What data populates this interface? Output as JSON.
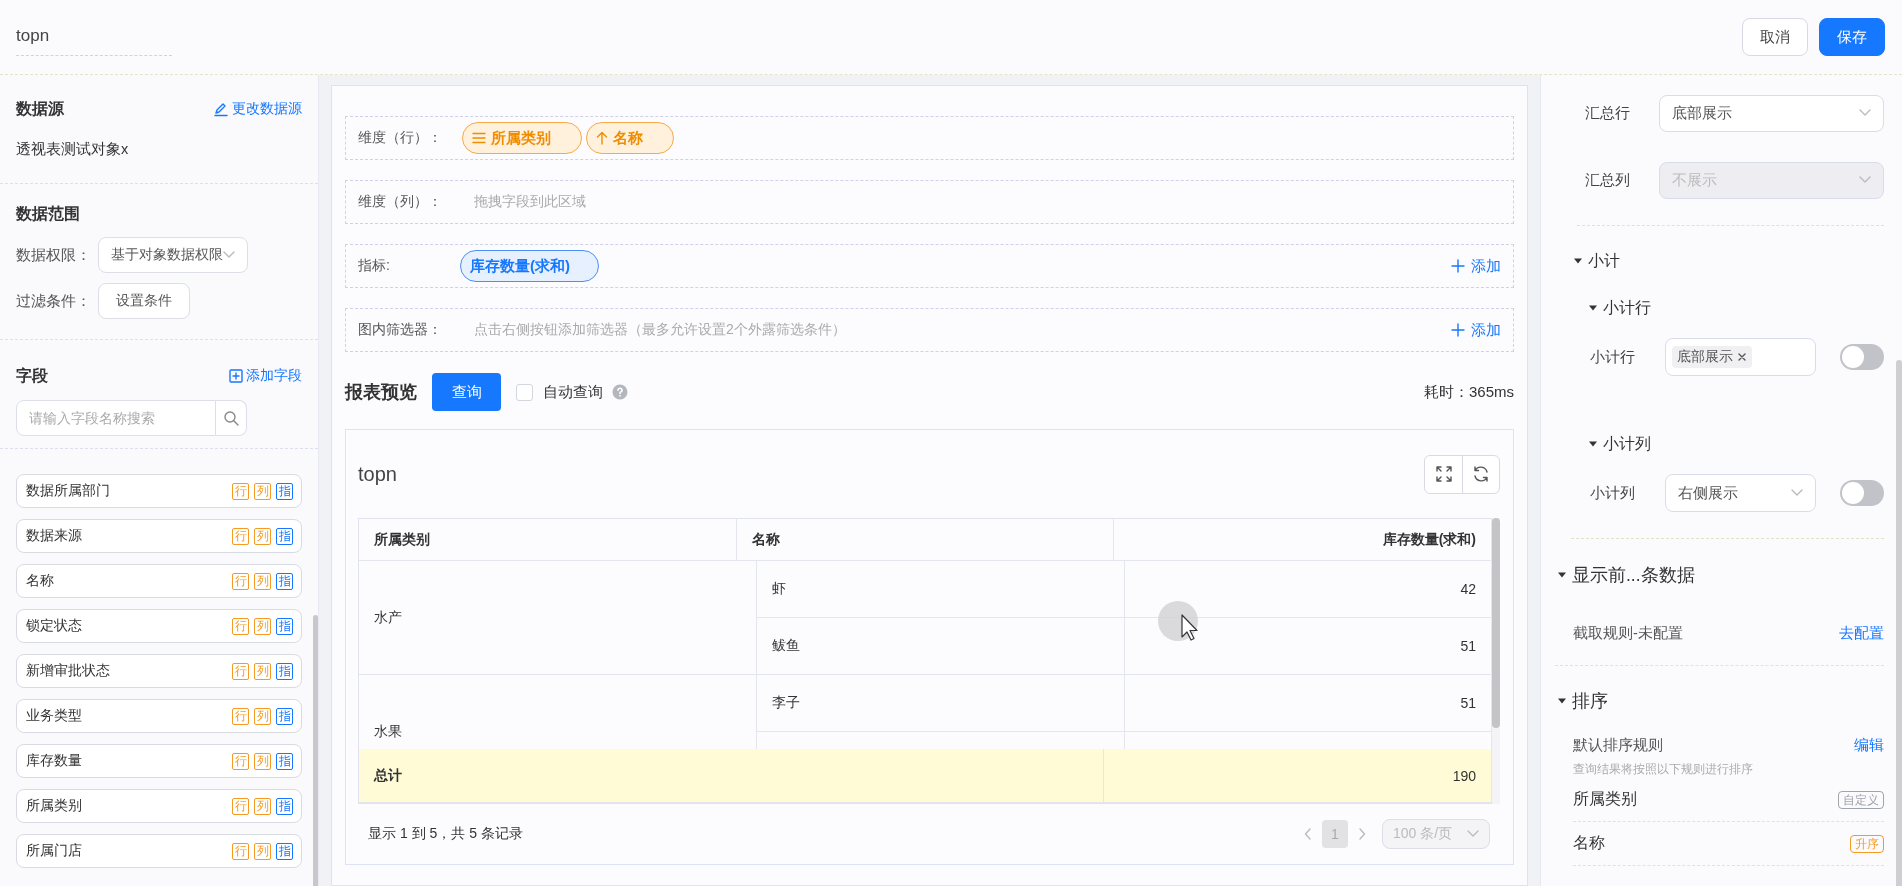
{
  "header": {
    "title": "topn",
    "buttons": [
      {
        "label": "取消",
        "kind": "default"
      },
      {
        "label": "保存",
        "kind": "primary"
      }
    ]
  },
  "datasource": {
    "title": "数据源",
    "action": "更改数据源",
    "value": "透视表测试对象x"
  },
  "data_range": {
    "title": "数据范围",
    "permission": {
      "label": "数据权限：",
      "value": "基于对象数据权限"
    },
    "filter": {
      "label": "过滤条件：",
      "button": "设置条件"
    }
  },
  "fields": {
    "title": "字段",
    "action": "添加字段",
    "search": {
      "placeholder": "请输入字段名称搜索"
    },
    "items": [
      {
        "name": "数据所属部门",
        "tags": [
          {
            "label": "行",
            "color": "#f59a23"
          },
          {
            "label": "列",
            "color": "#f59a23"
          },
          {
            "label": "指",
            "color": "#1677ff"
          }
        ]
      },
      {
        "name": "数据来源",
        "tags": [
          {
            "label": "行",
            "color": "#f59a23"
          },
          {
            "label": "列",
            "color": "#f59a23"
          },
          {
            "label": "指",
            "color": "#1677ff"
          }
        ]
      },
      {
        "name": "名称",
        "tags": [
          {
            "label": "行",
            "color": "#f59a23"
          },
          {
            "label": "列",
            "color": "#f59a23"
          },
          {
            "label": "指",
            "color": "#1677ff"
          }
        ]
      },
      {
        "name": "锁定状态",
        "tags": [
          {
            "label": "行",
            "color": "#f59a23"
          },
          {
            "label": "列",
            "color": "#f59a23"
          },
          {
            "label": "指",
            "color": "#1677ff"
          }
        ]
      },
      {
        "name": "新增审批状态",
        "tags": [
          {
            "label": "行",
            "color": "#f59a23"
          },
          {
            "label": "列",
            "color": "#f59a23"
          },
          {
            "label": "指",
            "color": "#1677ff"
          }
        ]
      },
      {
        "name": "业务类型",
        "tags": [
          {
            "label": "行",
            "color": "#f59a23"
          },
          {
            "label": "列",
            "color": "#f59a23"
          },
          {
            "label": "指",
            "color": "#1677ff"
          }
        ]
      },
      {
        "name": "库存数量",
        "tags": [
          {
            "label": "行",
            "color": "#f59a23"
          },
          {
            "label": "列",
            "color": "#f59a23"
          },
          {
            "label": "指",
            "color": "#1677ff"
          }
        ]
      },
      {
        "name": "所属类别",
        "tags": [
          {
            "label": "行",
            "color": "#f59a23"
          },
          {
            "label": "列",
            "color": "#f59a23"
          },
          {
            "label": "指",
            "color": "#1677ff"
          }
        ]
      },
      {
        "name": "所属门店",
        "tags": [
          {
            "label": "行",
            "color": "#f59a23"
          },
          {
            "label": "列",
            "color": "#f59a23"
          },
          {
            "label": "指",
            "color": "#1677ff"
          }
        ]
      }
    ]
  },
  "zones": [
    {
      "label": "维度（行）：",
      "chips": [
        {
          "label": "所属类别",
          "kind": "custom"
        },
        {
          "label": "名称",
          "kind": "asc"
        }
      ]
    },
    {
      "label": "维度（列）：",
      "hint": "拖拽字段到此区域"
    },
    {
      "label": "指标:",
      "chips": [
        {
          "label": "库存数量(求和)",
          "kind": "measure"
        }
      ],
      "add": "添加"
    },
    {
      "label": "图内筛选器：",
      "hint": "点击右侧按钮添加筛选器（最多允许设置2个外露筛选条件）",
      "add": "添加"
    }
  ],
  "preview": {
    "title": "报表预览",
    "query_button": "查询",
    "auto_query": {
      "label": "自动查询",
      "checked": false
    },
    "elapsed": "耗时：365ms"
  },
  "report": {
    "title": "topn",
    "table": {
      "columns": [
        "所属类别",
        "名称",
        "库存数量(求和)"
      ],
      "groups": [
        {
          "category": "水产",
          "rows": [
            {
              "name": "虾",
              "value": "42"
            },
            {
              "name": "鲅鱼",
              "value": "51"
            }
          ]
        },
        {
          "category": "水果",
          "rows": [
            {
              "name": "李子",
              "value": "51"
            }
          ]
        }
      ],
      "total": {
        "label": "总计",
        "value": "190"
      }
    },
    "pagination": {
      "summary": "显示 1 到 5，共 5 条记录",
      "pages": [
        {
          "label": "1",
          "selected": true
        }
      ],
      "page_size": "100 条/页"
    }
  },
  "summary": {
    "rows": [
      {
        "label": "汇总行",
        "value": "底部展示",
        "disabled": false
      },
      {
        "label": "汇总列",
        "value": "不展示",
        "disabled": true
      }
    ]
  },
  "subtotal": {
    "title": "小计",
    "expanded": true,
    "sections": [
      {
        "title": "小计行",
        "expanded": true,
        "label": "小计行",
        "kind": "tags",
        "tags": [
          "底部展示"
        ],
        "on": false
      },
      {
        "title": "小计列",
        "expanded": true,
        "label": "小计列",
        "kind": "select",
        "value": "右侧展示",
        "on": false
      }
    ]
  },
  "topn": {
    "title": "显示前...条数据",
    "expanded": true,
    "rule": "截取规则-未配置",
    "action": "去配置"
  },
  "sort": {
    "title": "排序",
    "expanded": true,
    "rule_title": "默认排序规则",
    "action": "编辑",
    "hint": "查询结果将按照以下规则进行排序",
    "items": [
      {
        "field": "所属类别",
        "tag": "自定义",
        "color": "#a0a4ad"
      },
      {
        "field": "名称",
        "tag": "升序",
        "color": "#f59a23"
      }
    ]
  }
}
